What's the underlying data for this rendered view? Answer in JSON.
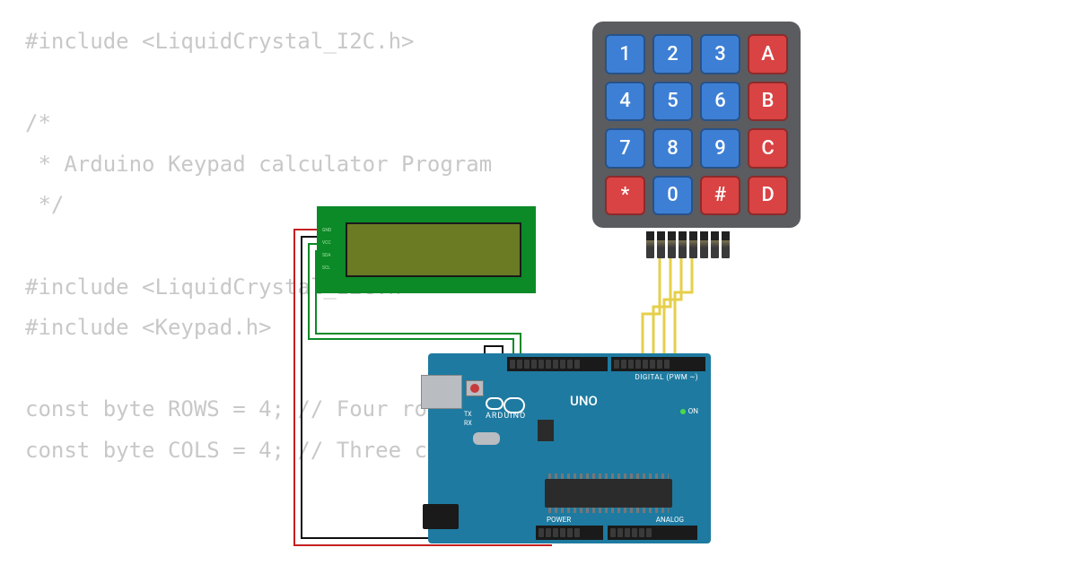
{
  "code": {
    "line1": "#include <LiquidCrystal_I2C.h>",
    "line2": "",
    "line3": "/*",
    "line4": " * Arduino Keypad calculator Program",
    "line5": " */",
    "line6": "",
    "line7": "#include <LiquidCrystal_I2C.h>",
    "line8": "#include <Keypad.h>",
    "line9": "",
    "line10": "const byte ROWS = 4; // Four rows",
    "line11": "const byte COLS = 4; // Three columns"
  },
  "keypad": {
    "rows": [
      [
        {
          "label": "1",
          "color": "blue"
        },
        {
          "label": "2",
          "color": "blue"
        },
        {
          "label": "3",
          "color": "blue"
        },
        {
          "label": "A",
          "color": "red"
        }
      ],
      [
        {
          "label": "4",
          "color": "blue"
        },
        {
          "label": "5",
          "color": "blue"
        },
        {
          "label": "6",
          "color": "blue"
        },
        {
          "label": "B",
          "color": "red"
        }
      ],
      [
        {
          "label": "7",
          "color": "blue"
        },
        {
          "label": "8",
          "color": "blue"
        },
        {
          "label": "9",
          "color": "blue"
        },
        {
          "label": "C",
          "color": "red"
        }
      ],
      [
        {
          "label": "*",
          "color": "red"
        },
        {
          "label": "0",
          "color": "blue"
        },
        {
          "label": "#",
          "color": "red"
        },
        {
          "label": "D",
          "color": "red"
        }
      ]
    ]
  },
  "lcd": {
    "pin_labels": [
      "GND",
      "VCC",
      "SDA",
      "SCL"
    ]
  },
  "arduino": {
    "brand": "ARDUINO",
    "model": "UNO",
    "digital_label": "DIGITAL (PWM ~)",
    "power_label": "POWER",
    "analog_label": "ANALOG",
    "on_label": "ON",
    "tx_label": "TX",
    "rx_label": "RX"
  },
  "diagram": {
    "components": [
      "keypad-4x4",
      "lcd1602-i2c",
      "arduino-uno"
    ],
    "wires": [
      {
        "color": "#c42020",
        "from": "lcd.VCC",
        "to": "arduino.5V"
      },
      {
        "color": "#111",
        "from": "lcd.GND",
        "to": "arduino.GND"
      },
      {
        "color": "#0b8a27",
        "from": "lcd.SDA",
        "to": "arduino.A4"
      },
      {
        "color": "#0b8a27",
        "from": "lcd.SCL",
        "to": "arduino.A5"
      },
      {
        "color": "#e6cf4a",
        "from": "keypad.col1",
        "to": "arduino.D"
      },
      {
        "color": "#e6cf4a",
        "from": "keypad.col2",
        "to": "arduino.D"
      },
      {
        "color": "#e6cf4a",
        "from": "keypad.col3",
        "to": "arduino.D"
      },
      {
        "color": "#e6cf4a",
        "from": "keypad.col4",
        "to": "arduino.D"
      }
    ]
  }
}
